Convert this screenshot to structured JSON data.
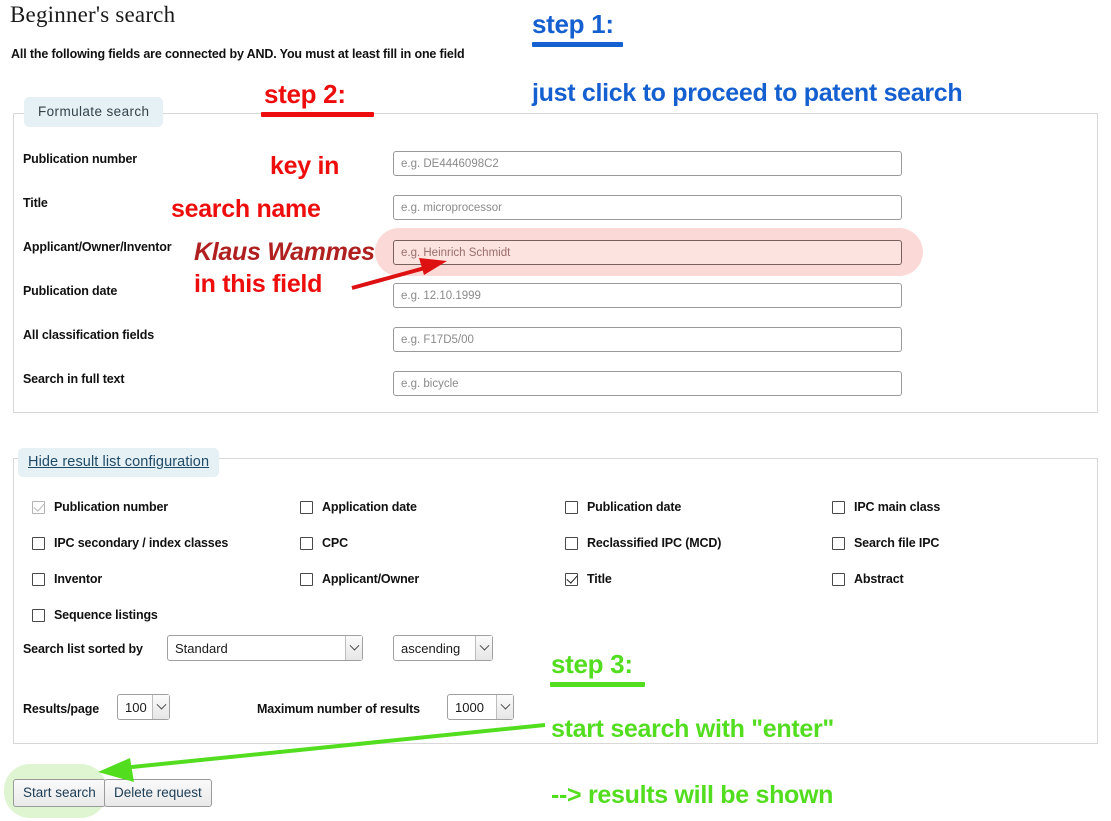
{
  "header": {
    "title": "Beginner's search",
    "subtitle": "All the following fields are connected by AND. You must at least fill in one field"
  },
  "tabs": {
    "formulate_search": "Formulate search",
    "hide_result_list_configuration": "Hide result list configuration"
  },
  "form": {
    "fields": [
      {
        "label": "Publication number",
        "placeholder": "e.g. DE4446098C2",
        "value": "",
        "highlighted": false
      },
      {
        "label": "Title",
        "placeholder": "e.g. microprocessor",
        "value": "",
        "highlighted": false
      },
      {
        "label": "Applicant/Owner/Inventor",
        "placeholder": "e.g. Heinrich Schmidt",
        "value": "",
        "highlighted": true
      },
      {
        "label": "Publication date",
        "placeholder": "e.g. 12.10.1999",
        "value": "",
        "highlighted": false
      },
      {
        "label": "All classification fields",
        "placeholder": "e.g. F17D5/00",
        "value": "",
        "highlighted": false
      },
      {
        "label": "Search in full text",
        "placeholder": "e.g. bicycle",
        "value": "",
        "highlighted": false
      }
    ]
  },
  "config": {
    "checkboxes": [
      {
        "label": "Publication number",
        "checked": true,
        "disabled": true,
        "col": 0,
        "row": 0
      },
      {
        "label": "Application date",
        "checked": false,
        "disabled": false,
        "col": 1,
        "row": 0
      },
      {
        "label": "Publication date",
        "checked": false,
        "disabled": false,
        "col": 2,
        "row": 0
      },
      {
        "label": "IPC main class",
        "checked": false,
        "disabled": false,
        "col": 3,
        "row": 0
      },
      {
        "label": "IPC secondary / index classes",
        "checked": false,
        "disabled": false,
        "col": 0,
        "row": 1
      },
      {
        "label": "CPC",
        "checked": false,
        "disabled": false,
        "col": 1,
        "row": 1
      },
      {
        "label": "Reclassified IPC (MCD)",
        "checked": false,
        "disabled": false,
        "col": 2,
        "row": 1
      },
      {
        "label": "Search file IPC",
        "checked": false,
        "disabled": false,
        "col": 3,
        "row": 1
      },
      {
        "label": "Inventor",
        "checked": false,
        "disabled": false,
        "col": 0,
        "row": 2
      },
      {
        "label": "Applicant/Owner",
        "checked": false,
        "disabled": false,
        "col": 1,
        "row": 2
      },
      {
        "label": "Title",
        "checked": true,
        "disabled": false,
        "col": 2,
        "row": 2
      },
      {
        "label": "Abstract",
        "checked": false,
        "disabled": false,
        "col": 3,
        "row": 2
      },
      {
        "label": "Sequence listings",
        "checked": false,
        "disabled": false,
        "col": 0,
        "row": 3
      }
    ],
    "sort_label": "Search list sorted by",
    "sort_value": "Standard",
    "order_value": "ascending",
    "results_per_page_label": "Results/page",
    "results_per_page_value": "100",
    "max_results_label": "Maximum number of results",
    "max_results_value": "1000"
  },
  "buttons": {
    "start_search": "Start search",
    "delete_request": "Delete request"
  },
  "annotations": {
    "step1": "step 1:",
    "step1_text": "just click to proceed to patent search",
    "step2": "step 2:",
    "step2_line1": "key in",
    "step2_line2": "search name",
    "step2_name": "Klaus Wammes",
    "step2_line3": "in this field",
    "step3": "step 3:",
    "step3_text": "start search with \"enter\"",
    "step3_result": "--> results will be shown"
  },
  "colors": {
    "red": "#ee0d0d",
    "dark_red": "#b02020",
    "blue": "#1560d0",
    "green": "#52dd1f",
    "pink_highlight": "#fbd9d6",
    "green_halo": "#dff5d2",
    "tab_bg": "#e6f1f5"
  }
}
